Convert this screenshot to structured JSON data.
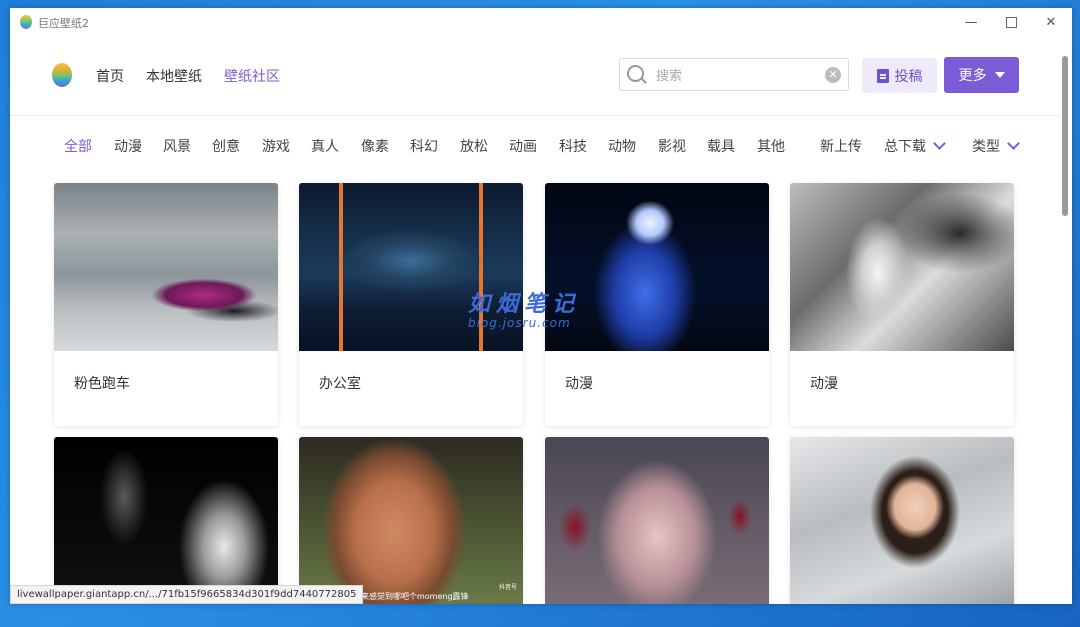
{
  "window": {
    "title": "巨应壁纸2"
  },
  "nav": {
    "items": [
      "首页",
      "本地壁纸",
      "壁纸社区"
    ],
    "active_index": 2
  },
  "search": {
    "placeholder": "搜索",
    "value": ""
  },
  "buttons": {
    "submit": "投稿",
    "more": "更多"
  },
  "categories": [
    "全部",
    "动漫",
    "风景",
    "创意",
    "游戏",
    "真人",
    "像素",
    "科幻",
    "放松",
    "动画",
    "科技",
    "动物",
    "影视",
    "载具",
    "其他"
  ],
  "active_category_index": 0,
  "sort": {
    "new": "新上传",
    "downloads": "总下载",
    "type": "类型"
  },
  "cards": [
    {
      "label": "粉色跑车"
    },
    {
      "label": "办公室"
    },
    {
      "label": "动漫"
    },
    {
      "label": "动漫"
    },
    {
      "label": ""
    },
    {
      "label": ""
    },
    {
      "label": ""
    },
    {
      "label": ""
    }
  ],
  "thumb_captions": {
    "card6_bottom": "来感觉到哪吧个momeng露锋",
    "card6_corner": "抖音号"
  },
  "watermark": {
    "main": "如烟笔记",
    "sub": "blog.josru.com"
  },
  "status": {
    "url": "livewallpaper.giantapp.cn/.../71fb15f9665834d301f9dd7440772805"
  },
  "colors": {
    "accent": "#7b5cd6",
    "accent_light": "#eeeaf9"
  }
}
